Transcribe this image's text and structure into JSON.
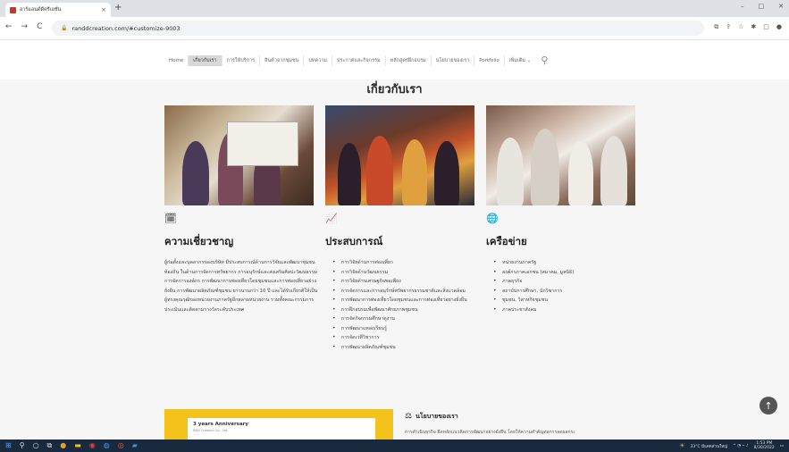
{
  "browser": {
    "tab_title": "อาร์แอนด์ดีครีเอชั่น",
    "url": "randdcreation.com/#customize-9003",
    "new_tab": "+",
    "close": "×",
    "back": "←",
    "forward": "→",
    "reload": "C",
    "lock": "🔒"
  },
  "nav": {
    "items": [
      {
        "label": "Home"
      },
      {
        "label": "เกี่ยวกับเรา"
      },
      {
        "label": "การให้บริการ"
      },
      {
        "label": "สินค้าจากชุมชน"
      },
      {
        "label": "บทความ"
      },
      {
        "label": "ประกาศและกิจกรรม"
      },
      {
        "label": "หลักสูตรฝึกอบรม"
      },
      {
        "label": "นโยบายของเรา"
      },
      {
        "label": "Portfolio"
      },
      {
        "label": "เพิ่มเติม ⌄"
      }
    ],
    "active_index": 1
  },
  "page": {
    "heading": "เกี่ยวกับเรา"
  },
  "sections": [
    {
      "title": "ความเชี่ยวชาญ",
      "icon": "calendar-check-icon",
      "text": "ผู้ก่อตั้งและบุคลากรของบริษัท มีประสบการณ์ด้านการวิจัยและพัฒนาชุมชน ท้องถิ่น ในด้านการจัดการทรัพยากร การอนุรักษ์และส่งเสริมศิลปะวัฒนธรรม การจัดการองค์กร การพัฒนาการท่องเที่ยวโดยชุมชนและการท่องเที่ยวอย่างยั่งยืน การพัฒนาผลิตภัณฑ์ชุมชน ยาวนานกว่า 10 ปี และได้รับเกียรติให้เป็นผู้ทรงคุณวุฒิของหน่วยงานภาครัฐอีกหลายหน่วยงาน รวมทั้งคณะกรรมการประเมินและติดตามรางวัลระดับประเทศ"
    },
    {
      "title": "ประสบการณ์",
      "icon": "chart-line-icon",
      "items": [
        "การวิจัยด้านการท่องเที่ยว",
        "การวิจัยด้านวัฒนธรรม",
        "การวิจัยด้านเศรษฐกิจพอเพียง",
        "การจัดการและการอนุรักษ์ทรัพยากรธรรมชาติและสิ่งแวดล้อม",
        "การพัฒนาการท่องเที่ยวโดยชุมชนและการท่องเที่ยวอย่างยั่งยืน",
        "การฝึกอบรมเพื่อพัฒนาศักยภาพชุมชน",
        "การจัดกิจกรรมศึกษาดูงาน",
        "การพัฒนาแหล่งเรียนรู้",
        "การจัดเวทีวิชาการ",
        "การพัฒนาผลิตภัณฑ์ชุมชน"
      ]
    },
    {
      "title": "เครือข่าย",
      "icon": "globe-icon",
      "items": [
        "หน่วยงานภาครัฐ",
        "องค์กรภาคเอกชน (สมาคม, มูลนิธิ)",
        "ภาคธุรกิจ",
        "สถาบันการศึกษา, นักวิชาการ",
        "ชุมชน, วิสาหกิจชุมชน",
        "ภาคประชาสังคม"
      ]
    }
  ],
  "banner": {
    "title": "3 years Anniversary",
    "subtitle": "R&D Creation Co., Ltd."
  },
  "policy": {
    "title": "นโยบายของเรา",
    "text": "การดำเนินธุรกิจ ยึดหลักแนวคิดการพัฒนาอย่างยั่งยืน โดยให้ความสำคัญต่อการลดผลกระ"
  },
  "taskbar": {
    "weather": "33°C มีแดดส่วนใหญ่",
    "time": "1:53 PM",
    "date": "8/30/2022"
  }
}
